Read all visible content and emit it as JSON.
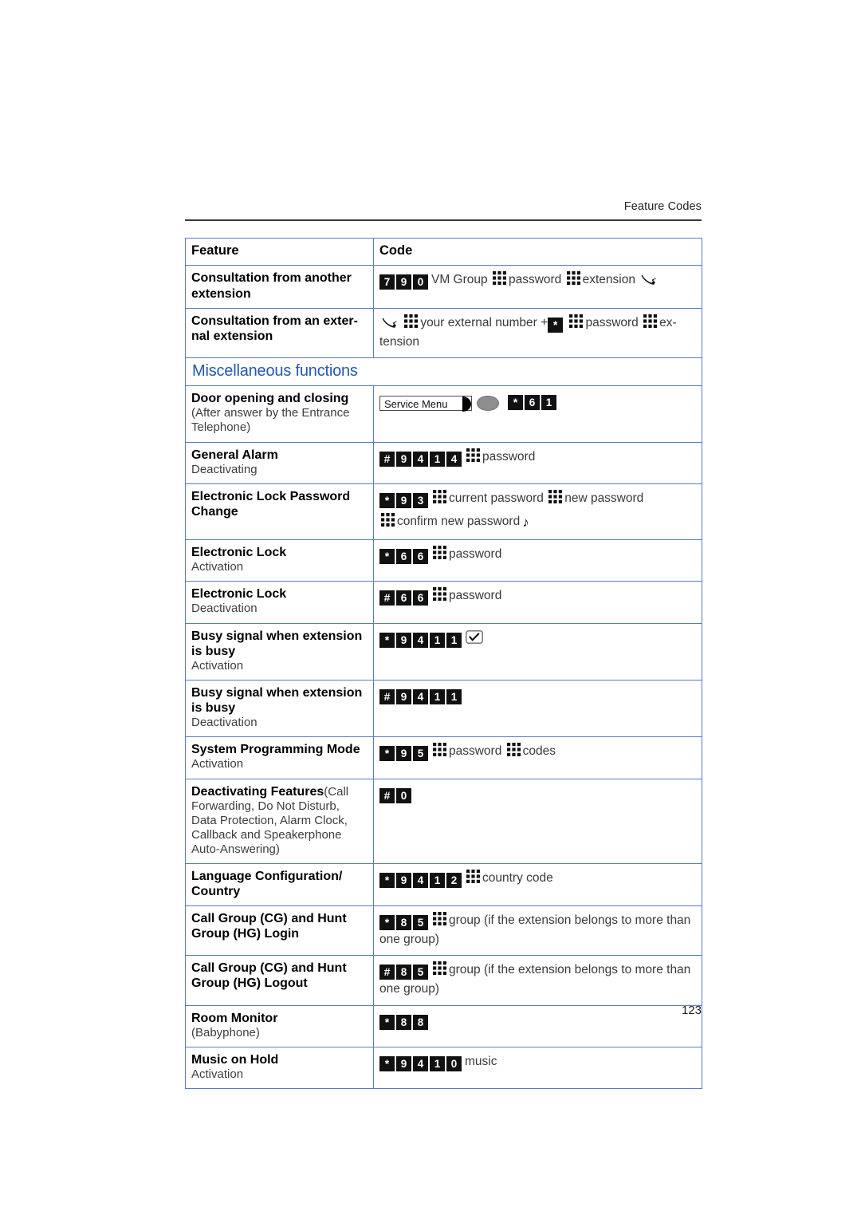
{
  "header": {
    "running_title": "Feature Codes"
  },
  "folio": {
    "page_number": "123"
  },
  "table": {
    "columns": [
      "Feature",
      "Code"
    ],
    "section_heading": "Miscellaneous functions",
    "rows": [
      {
        "feature_title": "Consultation from another extension",
        "feature_sub": "",
        "code_line1": {
          "keys": [
            "7",
            "9",
            "0"
          ],
          "text_after": "VM Group"
        },
        "code_text_password": "password",
        "code_text_extension": "extension"
      },
      {
        "feature_title": "Consultation from an exter-",
        "feature_title2": "nal extension",
        "code_text_number": "your external number +",
        "code_star": "*",
        "code_text_password": "password",
        "code_text_extension": "ex-tension"
      },
      {
        "feature_title": "Door opening and closing",
        "feature_sub": "(After answer by the Entrance Telephone)",
        "display_label": "Service Menu",
        "keys": [
          "*",
          "6",
          "1"
        ]
      },
      {
        "feature_title": "General Alarm",
        "feature_sub": "Deactivating",
        "keys": [
          "#",
          "9",
          "4",
          "1",
          "4"
        ],
        "code_text_password": "password"
      },
      {
        "feature_title": "Electronic Lock Password Change",
        "feature_sub": "",
        "keys": [
          "*",
          "9",
          "3"
        ],
        "text_current": "current password",
        "text_new": "new password",
        "text_confirm": "confirm new password"
      },
      {
        "feature_title": "Electronic Lock",
        "feature_sub": "Activation",
        "keys": [
          "*",
          "6",
          "6"
        ],
        "code_text_password": "password"
      },
      {
        "feature_title": "Electronic Lock",
        "feature_sub": "Deactivation",
        "keys": [
          "#",
          "6",
          "6"
        ],
        "code_text_password": "password"
      },
      {
        "feature_title": "Busy signal when extension is busy",
        "feature_sub": "Activation",
        "keys": [
          "*",
          "9",
          "4",
          "1",
          "1"
        ]
      },
      {
        "feature_title": "Busy signal when extension is busy",
        "feature_sub": "Deactivation",
        "keys": [
          "#",
          "9",
          "4",
          "1",
          "1"
        ]
      },
      {
        "feature_title": "System Programming Mode",
        "feature_sub": "Activation",
        "keys": [
          "*",
          "9",
          "5"
        ],
        "code_text_password": "password",
        "code_text_codes": "codes"
      },
      {
        "feature_title": "Deactivating Features",
        "feature_inline": "(Call Forwarding, Do Not Disturb, Data Protection, Alarm Clock, Callback and Speakerphone Auto-Answering)",
        "keys": [
          "#",
          "0"
        ]
      },
      {
        "feature_title": "Language Configuration/ Country",
        "feature_sub": "",
        "keys": [
          "*",
          "9",
          "4",
          "1",
          "2"
        ],
        "code_text_country": "country code"
      },
      {
        "feature_title": "Call Group (CG) and Hunt Group (HG) Login",
        "feature_sub": "",
        "keys": [
          "*",
          "8",
          "5"
        ],
        "code_text_group": "group (if the extension belongs to more than one group)"
      },
      {
        "feature_title": "Call Group (CG) and Hunt Group (HG) Logout",
        "feature_sub": "",
        "keys": [
          "#",
          "8",
          "5"
        ],
        "code_text_group": "group (if the extension belongs to more than one group)"
      },
      {
        "feature_title": "Room Monitor",
        "feature_sub": "(Babyphone)",
        "keys": [
          "*",
          "8",
          "8"
        ]
      },
      {
        "feature_title": "Music on Hold",
        "feature_sub": "Activation",
        "keys": [
          "*",
          "9",
          "4",
          "1",
          "0"
        ],
        "code_text_music": "music"
      }
    ]
  },
  "icons": {
    "keypad": "keypad-icon",
    "handset": "handset-icon",
    "ok_key": "checkmark-key-icon",
    "note": "♪"
  },
  "colors": {
    "section_heading": "#2558b0",
    "table_border": "#5b79c4",
    "key_background": "#111111",
    "oval_button": "#8e8e8e"
  }
}
